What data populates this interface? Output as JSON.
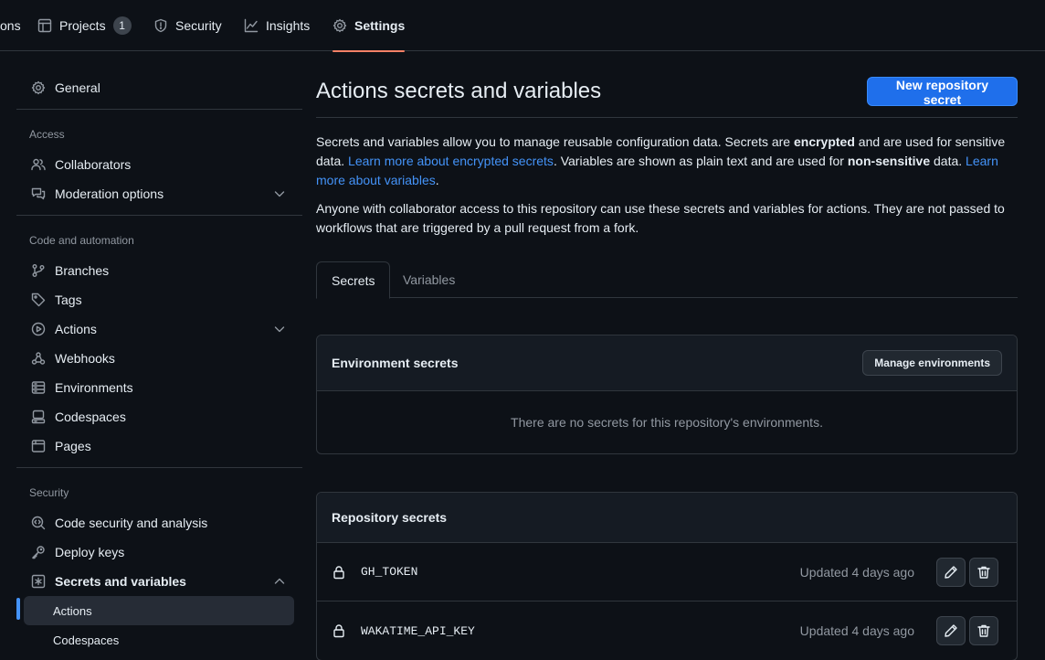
{
  "nav": {
    "tabs": [
      {
        "label": "ons"
      },
      {
        "label": "Projects",
        "count": "1"
      },
      {
        "label": "Security"
      },
      {
        "label": "Insights"
      },
      {
        "label": "Settings"
      }
    ]
  },
  "sidebar": {
    "general": "General",
    "access_label": "Access",
    "access": [
      "Collaborators",
      "Moderation options"
    ],
    "code_label": "Code and automation",
    "code": [
      "Branches",
      "Tags",
      "Actions",
      "Webhooks",
      "Environments",
      "Codespaces",
      "Pages"
    ],
    "security_label": "Security",
    "security": [
      "Code security and analysis",
      "Deploy keys",
      "Secrets and variables"
    ],
    "secrets_sub": [
      "Actions",
      "Codespaces"
    ]
  },
  "main": {
    "title": "Actions secrets and variables",
    "new_secret_button": "New repository secret",
    "intro": {
      "t1": "Secrets and variables allow you to manage reusable configuration data. Secrets are ",
      "b1": "encrypted",
      "t2": " and are used for sensitive data. ",
      "link1": "Learn more about encrypted secrets",
      "t3": ". Variables are shown as plain text and are used for ",
      "b2": "non-sensitive",
      "t4": " data. ",
      "link2": "Learn more about variables",
      "t5": "."
    },
    "note": "Anyone with collaborator access to this repository can use these secrets and variables for actions. They are not passed to workflows that are triggered by a pull request from a fork.",
    "tabs": [
      "Secrets",
      "Variables"
    ],
    "env_secrets": {
      "title": "Environment secrets",
      "button": "Manage environments",
      "empty": "There are no secrets for this repository's environments."
    },
    "repo_secrets": {
      "title": "Repository secrets",
      "rows": [
        {
          "name": "GH_TOKEN",
          "updated": "Updated 4 days ago"
        },
        {
          "name": "WAKATIME_API_KEY",
          "updated": "Updated 4 days ago"
        }
      ]
    }
  },
  "colors": {
    "background": "#0d1117",
    "accent_blue": "#1f6feb",
    "link": "#4493f8",
    "selected_underline": "#f78166"
  }
}
